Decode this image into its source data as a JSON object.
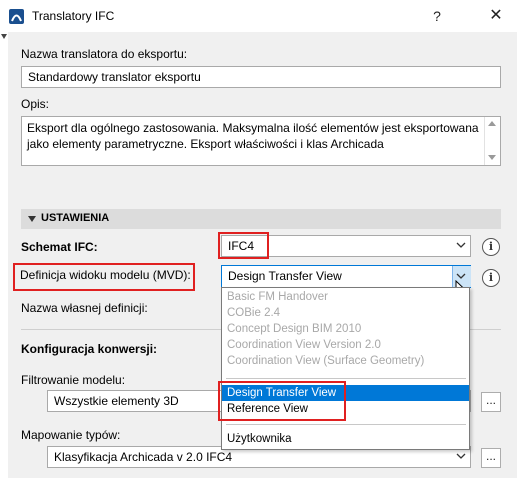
{
  "window": {
    "title": "Translatory IFC",
    "help_label": "?",
    "close_label": "✕",
    "app_icon": "archicad-icon"
  },
  "translator": {
    "name_label": "Nazwa translatora do eksportu:",
    "name_value": "Standardowy translator eksportu",
    "description_label": "Opis:",
    "description_value": "Eksport dla ogólnego zastosowania. Maksymalna ilość elementów jest eksportowana jako elementy parametryczne. Eksport właściwości i klas Archicada"
  },
  "settings": {
    "section_label": "USTAWIENIA",
    "schema_label": "Schemat IFC:",
    "schema_value": "IFC4",
    "mvd_label": "Definicja widoku modelu (MVD):",
    "mvd_value": "Design Transfer View",
    "custom_def_label": "Nazwa własnej definicji:",
    "conversion_label": "Konfiguracja konwersji:",
    "model_filter_label": "Filtrowanie modelu:",
    "model_filter_value": "Wszystkie elementy 3D",
    "type_mapping_label": "Mapowanie typów:",
    "type_mapping_value": "Klasyfikacja Archicada v 2.0 IFC4",
    "info_icon_label": "i",
    "dots_label": "..."
  },
  "mvd_dropdown": {
    "disabled_options": [
      "Basic FM Handover",
      "COBie 2.4",
      "Concept Design BIM 2010",
      "Coordination View Version 2.0",
      "Coordination View (Surface Geometry)"
    ],
    "enabled_options": [
      "Design Transfer View",
      "Reference View"
    ],
    "selected": "Design Transfer View",
    "user_option": "Użytkownika"
  },
  "colors": {
    "highlight": "#e02020",
    "selection": "#0078d7",
    "panel": "#f0f0f0"
  }
}
